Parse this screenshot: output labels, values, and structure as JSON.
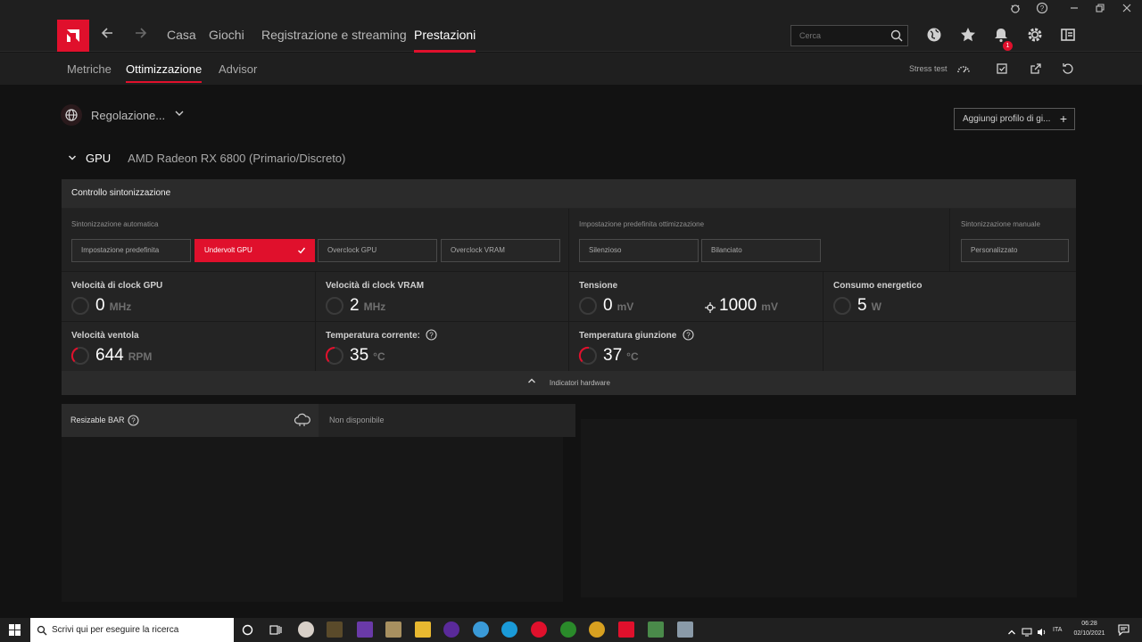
{
  "nav": {
    "items": [
      "Casa",
      "Giochi",
      "Registrazione e streaming",
      "Prestazioni"
    ],
    "search_placeholder": "Cerca",
    "notification_count": "1"
  },
  "subnav": {
    "tabs": [
      "Metriche",
      "Ottimizzazione",
      "Advisor"
    ],
    "stress_test": "Stress test"
  },
  "profile": {
    "label": "Regolazione...",
    "add_profile": "Aggiungi profilo di gi..."
  },
  "gpu": {
    "label": "GPU",
    "name": "AMD Radeon RX 6800 (Primario/Discreto)"
  },
  "tuning": {
    "title": "Controllo sintonizzazione",
    "auto": {
      "title": "Sintonizzazione automatica",
      "options": [
        "Impostazione predefinita",
        "Undervolt GPU",
        "Overclock GPU",
        "Overclock VRAM"
      ]
    },
    "preset": {
      "title": "Impostazione predefinita ottimizzazione",
      "options": [
        "Silenzioso",
        "Bilanciato"
      ]
    },
    "manual": {
      "title": "Sintonizzazione manuale",
      "options": [
        "Personalizzato"
      ]
    }
  },
  "metrics": {
    "gpu_clock": {
      "title": "Velocità di clock GPU",
      "value": "0",
      "unit": "MHz"
    },
    "vram_clock": {
      "title": "Velocità di clock VRAM",
      "value": "2",
      "unit": "MHz"
    },
    "voltage": {
      "title": "Tensione",
      "value": "0",
      "unit": "mV",
      "target": "1000",
      "target_unit": "mV"
    },
    "power": {
      "title": "Consumo energetico",
      "value": "5",
      "unit": "W"
    },
    "fan": {
      "title": "Velocità ventola",
      "value": "644",
      "unit": "RPM"
    },
    "temp": {
      "title": "Temperatura corrente:",
      "value": "35",
      "unit": "°C"
    },
    "junction": {
      "title": "Temperatura giunzione",
      "value": "37",
      "unit": "°C"
    }
  },
  "hardware_indicators": "Indicatori hardware",
  "resizable_bar": {
    "label": "Resizable BAR",
    "value": "Non disponibile"
  },
  "taskbar": {
    "search_placeholder": "Scrivi qui per eseguire la ricerca",
    "lang": "ITA",
    "time": "06:28",
    "date": "02/10/2021"
  },
  "colors": {
    "accent": "#e0102c",
    "background": "#121212",
    "panel": "#242424"
  }
}
